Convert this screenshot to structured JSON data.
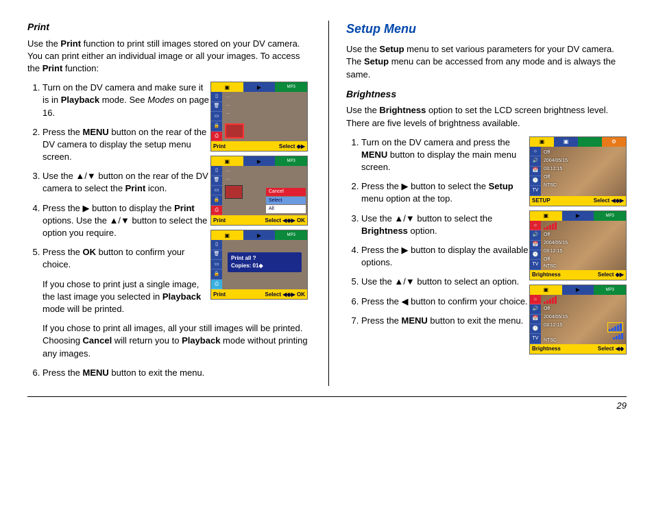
{
  "page_number": "29",
  "left": {
    "heading": "Print",
    "intro_parts": [
      "Use the ",
      "Print",
      " function to print still images stored on your DV camera. You can print either an individual image or all your images. To access the ",
      "Print",
      " function:"
    ],
    "steps": [
      {
        "pre": "Turn on the DV camera and make sure it is in ",
        "bold": "Playback",
        "post": " mode. See ",
        "ital": "Modes",
        "post2": " on page 16."
      },
      {
        "pre": "Press the ",
        "bold": "MENU",
        "post": " button on the rear of the DV camera to display the setup menu screen."
      },
      {
        "pre": "Use the ",
        "sym": "▲/▼",
        "post": " button on the rear of the DV camera to select the ",
        "bold": "Print",
        "post2": " icon."
      },
      {
        "pre": "Press the ",
        "sym": "▶",
        "post": " button to display the ",
        "bold": "Print",
        "post2": " options. Use the ",
        "sym2": "▲/▼",
        "post3": " button to select the option you require."
      },
      {
        "pre": "Press the ",
        "bold": "OK",
        "post": " button to confirm your choice."
      }
    ],
    "para1_parts": [
      "If you chose to print just a single image, the last image you selected in ",
      "Playback",
      " mode will be printed."
    ],
    "para2_parts": [
      "If you chose to print all images, all your still images will be printed. Choosing ",
      "Cancel",
      " will return you to ",
      "Playback",
      " mode without printing any images."
    ],
    "step6_parts": [
      "Press the ",
      "MENU",
      " button to exit the menu."
    ],
    "lcd1_foot_l": "Print",
    "lcd1_foot_r": "Select  ◆▶",
    "lcd2_foot_l": "Print",
    "lcd2_foot_r": "Select  ◀◆▶ OK",
    "lcd2_cancel": "Cancel",
    "lcd2_select": "Select",
    "lcd2_all": "All",
    "lcd3_foot_l": "Print",
    "lcd3_foot_r": "Select  ◀◆▶ OK",
    "lcd3_dialog_l1": "Print all ?",
    "lcd3_dialog_l2": "Copies: 01◆"
  },
  "right": {
    "heading": "Setup Menu",
    "intro_parts": [
      "Use the ",
      "Setup",
      " menu to set various parameters for your DV camera. The ",
      "Setup",
      " menu can be accessed from any mode and is always the same."
    ],
    "sub_heading": "Brightness",
    "sub_intro_parts": [
      "Use the ",
      "Brightness",
      " option to set the LCD screen brightness level. There are five levels of brightness available."
    ],
    "steps": [
      {
        "pre": "Turn on the DV camera and press the ",
        "bold": "MENU",
        "post": " button to display the main menu screen."
      },
      {
        "pre": "Press the ",
        "sym": "▶",
        "post": " button to select the ",
        "bold": "Setup",
        "post2": " menu option at the top."
      },
      {
        "pre": "Use the ",
        "sym": "▲/▼",
        "post": " button to select the ",
        "bold": "Brightness",
        "post2": " option."
      },
      {
        "pre": "Press the ",
        "sym": "▶",
        "post": " button to display the available options."
      },
      {
        "pre": "Use the ",
        "sym": "▲/▼",
        "post": " button to select an option."
      },
      {
        "pre": "Press the ",
        "sym": "◀",
        "post": " button to confirm your choice."
      },
      {
        "pre": "Press the ",
        "bold": "MENU",
        "post": " button to exit the menu."
      }
    ],
    "setup_off": "Off",
    "setup_date": "2004/05/15",
    "setup_time": "03:12:15",
    "setup_ntsc": "NTSC",
    "lcd1_foot_l": "SETUP",
    "lcd1_foot_r": "Select  ◀◆▶",
    "lcd2_foot_l": "Brightness",
    "lcd2_foot_r": "Select  ◆▶",
    "lcd3_foot_l": "Brightness",
    "lcd3_foot_r": "Select  ◀◆"
  }
}
